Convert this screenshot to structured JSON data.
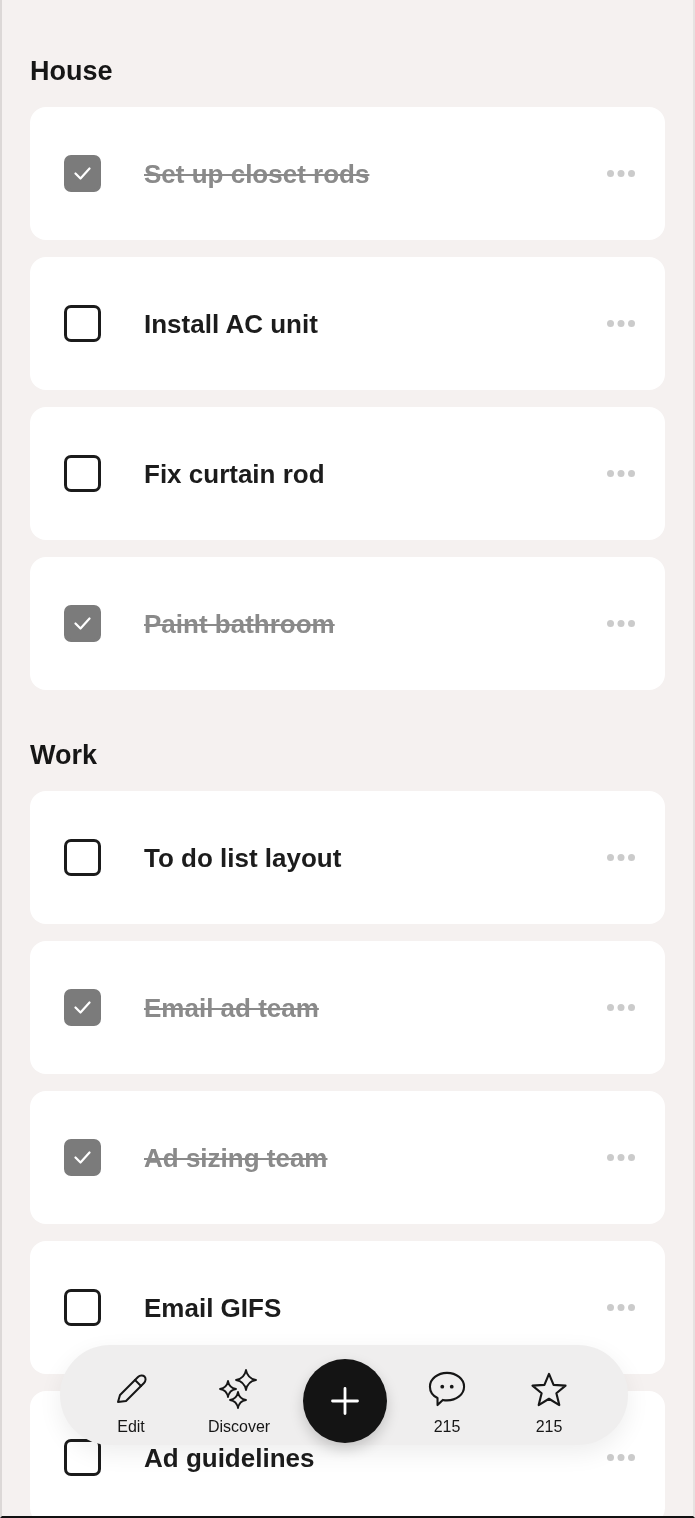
{
  "sections": [
    {
      "title": "House",
      "tasks": [
        {
          "label": "Set up closet rods",
          "checked": true
        },
        {
          "label": "Install AC unit",
          "checked": false
        },
        {
          "label": "Fix curtain rod",
          "checked": false
        },
        {
          "label": "Paint bathroom",
          "checked": true
        }
      ]
    },
    {
      "title": "Work",
      "tasks": [
        {
          "label": "To do list layout",
          "checked": false
        },
        {
          "label": "Email ad team",
          "checked": true
        },
        {
          "label": "Ad sizing team",
          "checked": true
        },
        {
          "label": "Email GIFS",
          "checked": false
        },
        {
          "label": "Ad guidelines",
          "checked": false
        }
      ]
    }
  ],
  "bottom_bar": {
    "items": [
      {
        "kind": "edit",
        "label": "Edit"
      },
      {
        "kind": "discover",
        "label": "Discover"
      },
      {
        "kind": "add"
      },
      {
        "kind": "comments",
        "label": "215"
      },
      {
        "kind": "favorites",
        "label": "215"
      }
    ]
  }
}
